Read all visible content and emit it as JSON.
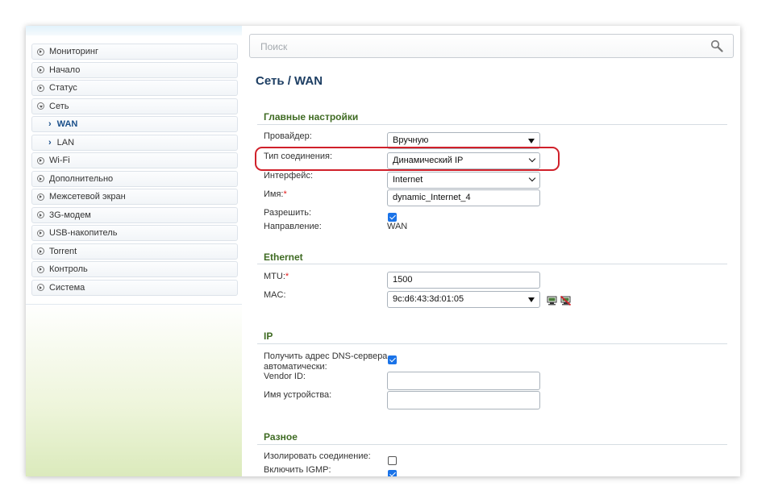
{
  "sidebar": {
    "items": [
      {
        "label": "Мониторинг"
      },
      {
        "label": "Начало"
      },
      {
        "label": "Статус"
      },
      {
        "label": "Сеть"
      },
      {
        "label": "WAN"
      },
      {
        "label": "LAN"
      },
      {
        "label": "Wi-Fi"
      },
      {
        "label": "Дополнительно"
      },
      {
        "label": "Межсетевой экран"
      },
      {
        "label": "3G-модем"
      },
      {
        "label": "USB-накопитель"
      },
      {
        "label": "Torrent"
      },
      {
        "label": "Контроль"
      },
      {
        "label": "Система"
      }
    ]
  },
  "search": {
    "placeholder": "Поиск",
    "icon": "search-icon"
  },
  "breadcrumb": {
    "text": "Сеть /  WAN"
  },
  "main_settings": {
    "title": "Главные настройки",
    "provider_label": "Провайдер:",
    "provider_value": "Вручную",
    "connection_type_label": "Тип соединения:",
    "connection_type_value": "Динамический IP",
    "interface_label": "Интерфейс:",
    "interface_value": "Internet",
    "name_label": "Имя:",
    "name_required": "*",
    "name_value": "dynamic_Internet_4",
    "enable_label": "Разрешить:",
    "enable_checked": true,
    "direction_label": "Направление:",
    "direction_value": "WAN"
  },
  "ethernet": {
    "title": "Ethernet",
    "mtu_label": "MTU:",
    "mtu_required": "*",
    "mtu_value": "1500",
    "mac_label": "MAC:",
    "mac_value": "9c:d6:43:3d:01:05",
    "icons": [
      "network-card-icon",
      "clone-mac-icon"
    ]
  },
  "ip": {
    "title": "IP",
    "dns_auto_label_1": "Получить адрес DNS-сервера",
    "dns_auto_label_2": "автоматически:",
    "dns_auto_checked": true,
    "vendor_id_label": "Vendor ID:",
    "vendor_id_value": "",
    "device_name_label": "Имя устройства:",
    "device_name_value": ""
  },
  "misc": {
    "title": "Разное",
    "isolate_label": "Изолировать соединение:",
    "isolate_checked": false,
    "igmp_label": "Включить IGMP:",
    "igmp_checked": true
  },
  "colors": {
    "title": "#1d3e63",
    "section": "#3f6b23",
    "required": "#e21b1b",
    "highlight": "#d0202a",
    "checkbox": "#1a73e8"
  }
}
